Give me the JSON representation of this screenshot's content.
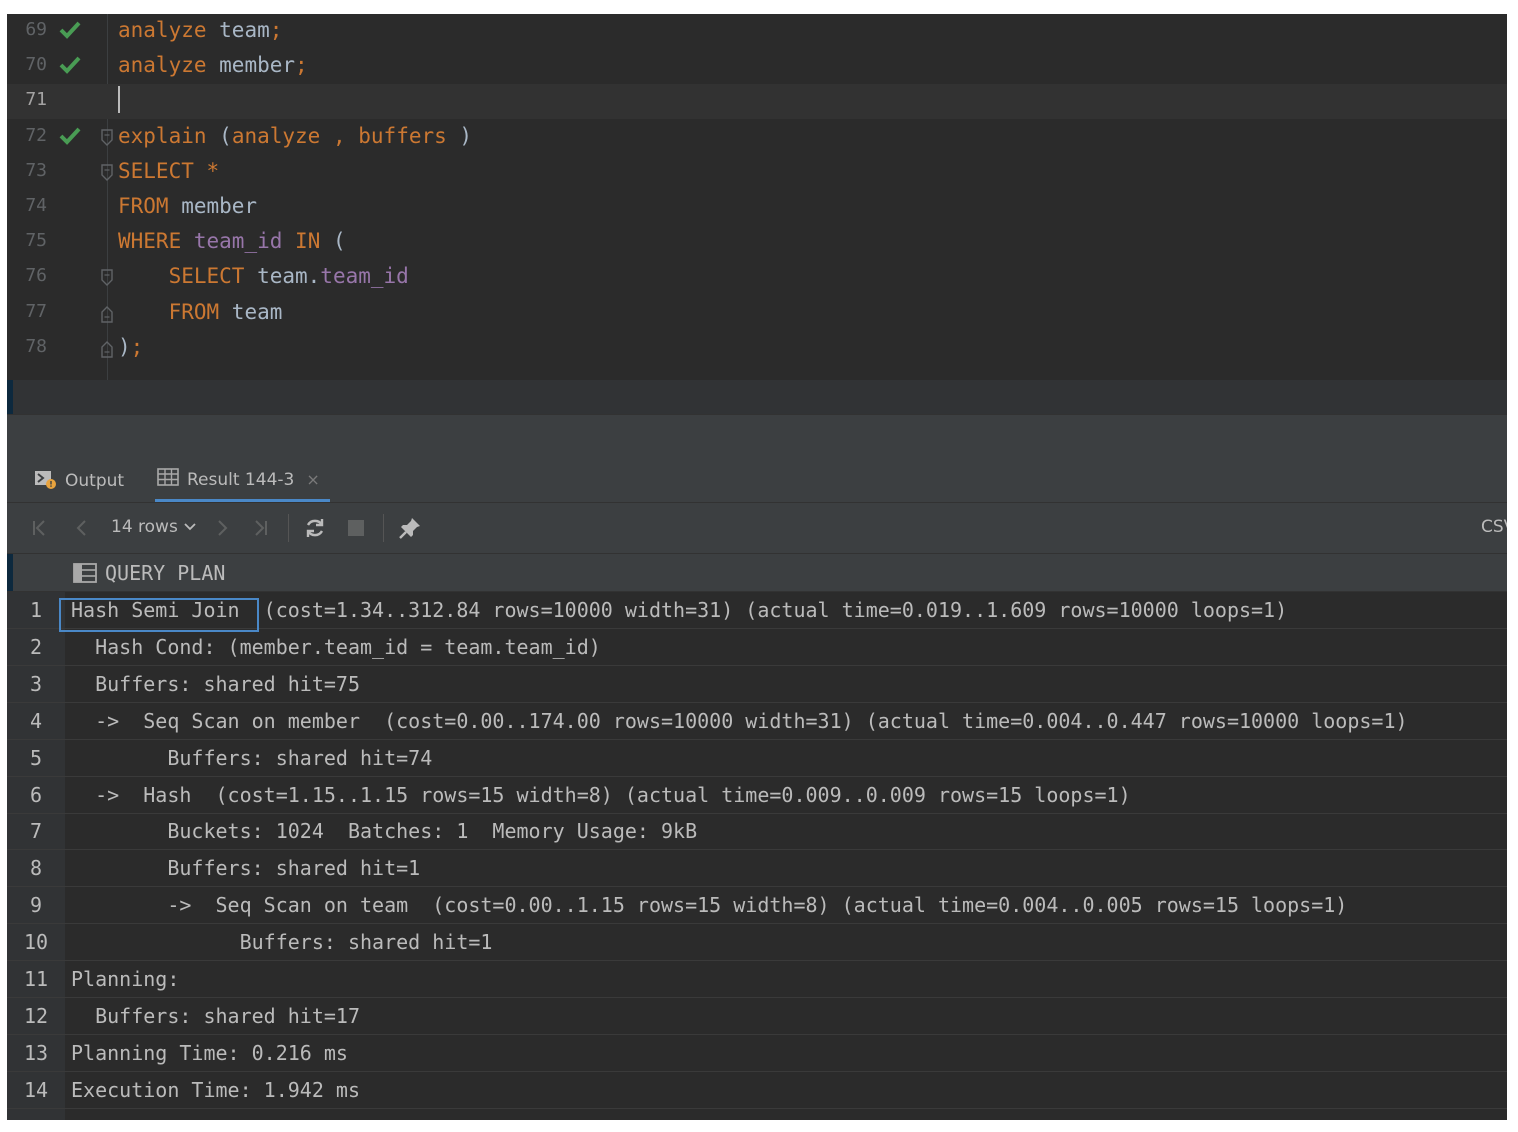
{
  "editor": {
    "lines": [
      {
        "num": "69",
        "status": "ok",
        "tokens": [
          {
            "t": "analyze",
            "c": "kw"
          },
          {
            "t": " team",
            "c": "plain"
          },
          {
            "t": ";",
            "c": "punct"
          }
        ]
      },
      {
        "num": "70",
        "status": "ok",
        "tokens": [
          {
            "t": "analyze",
            "c": "kw"
          },
          {
            "t": " member",
            "c": "plain"
          },
          {
            "t": ";",
            "c": "punct"
          }
        ]
      },
      {
        "num": "71",
        "status": "",
        "current": true,
        "tokens": []
      },
      {
        "num": "72",
        "status": "ok",
        "fold": "open",
        "tokens": [
          {
            "t": "explain",
            "c": "kw"
          },
          {
            "t": " (",
            "c": "plain"
          },
          {
            "t": "analyze",
            "c": "kw"
          },
          {
            "t": " , ",
            "c": "punct"
          },
          {
            "t": "buffers",
            "c": "kw"
          },
          {
            "t": " )",
            "c": "plain"
          }
        ]
      },
      {
        "num": "73",
        "status": "",
        "fold": "open",
        "tokens": [
          {
            "t": "SELECT",
            "c": "kw"
          },
          {
            "t": " ",
            "c": "plain"
          },
          {
            "t": "*",
            "c": "kw"
          }
        ]
      },
      {
        "num": "74",
        "status": "",
        "tokens": [
          {
            "t": "FROM",
            "c": "kw"
          },
          {
            "t": " member",
            "c": "plain"
          }
        ]
      },
      {
        "num": "75",
        "status": "",
        "tokens": [
          {
            "t": "WHERE",
            "c": "kw"
          },
          {
            "t": " ",
            "c": "plain"
          },
          {
            "t": "team_id",
            "c": "col"
          },
          {
            "t": " ",
            "c": "plain"
          },
          {
            "t": "IN",
            "c": "kw"
          },
          {
            "t": " (",
            "c": "plain"
          }
        ]
      },
      {
        "num": "76",
        "status": "",
        "fold": "open",
        "tokens": [
          {
            "t": "    ",
            "c": "plain"
          },
          {
            "t": "SELECT",
            "c": "kw"
          },
          {
            "t": " team.",
            "c": "plain"
          },
          {
            "t": "team_id",
            "c": "col"
          }
        ]
      },
      {
        "num": "77",
        "status": "",
        "fold": "end",
        "tokens": [
          {
            "t": "    ",
            "c": "plain"
          },
          {
            "t": "FROM",
            "c": "kw"
          },
          {
            "t": " team",
            "c": "plain"
          }
        ]
      },
      {
        "num": "78",
        "status": "",
        "fold": "end",
        "tokens": [
          {
            "t": ")",
            "c": "plain"
          },
          {
            "t": ";",
            "c": "punct"
          }
        ]
      }
    ]
  },
  "tabs": {
    "output_label": "Output",
    "result_label": "Result 144-3",
    "close_glyph": "×"
  },
  "toolbar": {
    "rows_label": "14 rows",
    "export_label": "CSV"
  },
  "grid": {
    "column_header": "QUERY PLAN",
    "rows": [
      {
        "n": "1",
        "text": "Hash Semi Join  (cost=1.34..312.84 rows=10000 width=31) (actual time=0.019..1.609 rows=10000 loops=1)"
      },
      {
        "n": "2",
        "text": "  Hash Cond: (member.team_id = team.team_id)"
      },
      {
        "n": "3",
        "text": "  Buffers: shared hit=75"
      },
      {
        "n": "4",
        "text": "  ->  Seq Scan on member  (cost=0.00..174.00 rows=10000 width=31) (actual time=0.004..0.447 rows=10000 loops=1)"
      },
      {
        "n": "5",
        "text": "        Buffers: shared hit=74"
      },
      {
        "n": "6",
        "text": "  ->  Hash  (cost=1.15..1.15 rows=15 width=8) (actual time=0.009..0.009 rows=15 loops=1)"
      },
      {
        "n": "7",
        "text": "        Buckets: 1024  Batches: 1  Memory Usage: 9kB"
      },
      {
        "n": "8",
        "text": "        Buffers: shared hit=1"
      },
      {
        "n": "9",
        "text": "        ->  Seq Scan on team  (cost=0.00..1.15 rows=15 width=8) (actual time=0.004..0.005 rows=15 loops=1)"
      },
      {
        "n": "10",
        "text": "              Buffers: shared hit=1"
      },
      {
        "n": "11",
        "text": "Planning:"
      },
      {
        "n": "12",
        "text": "  Buffers: shared hit=17"
      },
      {
        "n": "13",
        "text": "Planning Time: 0.216 ms"
      },
      {
        "n": "14",
        "text": "Execution Time: 1.942 ms"
      }
    ]
  },
  "colors": {
    "keyword": "#cc7832",
    "column": "#9876aa",
    "plain": "#a9b7c6",
    "check": "#499c54",
    "selection": "#4a88c7"
  }
}
